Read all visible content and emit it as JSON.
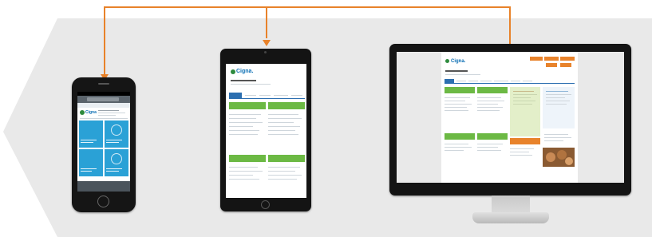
{
  "colors": {
    "background_arrow": "#e9e9e9",
    "connector": "#e8822a",
    "device_frame": "#161616",
    "brand_blue": "#0a6eb4",
    "tile_blue": "#2aa1d6",
    "tile_green": "#6cb944",
    "tile_orange": "#e8832c"
  },
  "icons": {
    "brand": "cigna-tree-icon",
    "connector_heads": "arrow-down-icon"
  },
  "phone": {
    "logo": "Cigna"
  },
  "tablet": {
    "logo": "Cigna."
  },
  "desktop": {
    "logo": "Cigna."
  }
}
